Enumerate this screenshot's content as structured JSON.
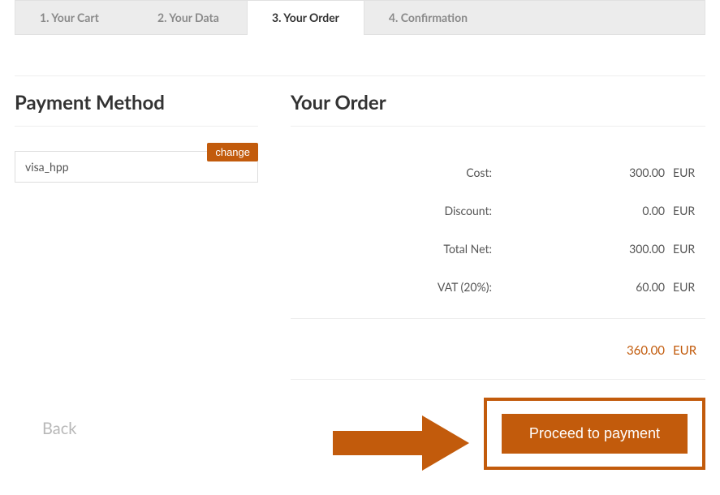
{
  "tabs": {
    "t1": "1. Your Cart",
    "t2": "2. Your Data",
    "t3": "3. Your Order",
    "t4": "4. Confirmation"
  },
  "payment": {
    "heading": "Payment Method",
    "change_label": "change",
    "method": "visa_hpp"
  },
  "order": {
    "heading": "Your Order",
    "lines": {
      "cost": {
        "label": "Cost:",
        "value": "300.00",
        "curr": "EUR"
      },
      "discount": {
        "label": "Discount:",
        "value": "0.00",
        "curr": "EUR"
      },
      "net": {
        "label": "Total Net:",
        "value": "300.00",
        "curr": "EUR"
      },
      "vat": {
        "label": "VAT (20%):",
        "value": "60.00",
        "curr": "EUR"
      }
    },
    "total": {
      "value": "360.00",
      "curr": "EUR"
    }
  },
  "footer": {
    "back": "Back",
    "proceed": "Proceed to payment"
  },
  "colors": {
    "accent": "#c25b0c"
  }
}
